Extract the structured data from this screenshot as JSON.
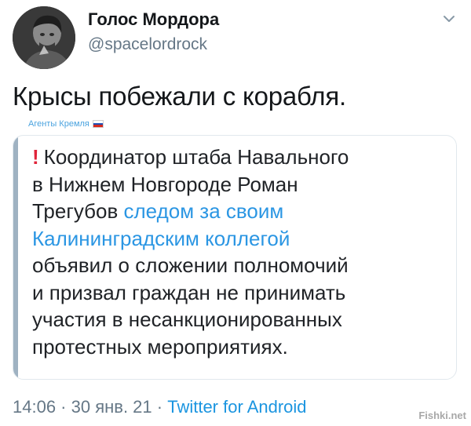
{
  "author": {
    "display_name": "Голос Мордора",
    "handle": "@spacelordrock"
  },
  "tweet": {
    "text": "Крысы побежали с корабля."
  },
  "source_caption": {
    "label": "Агенты Кремля",
    "flag_colors": [
      "#ffffff",
      "#1f4fb5",
      "#d52b1e"
    ]
  },
  "card": {
    "exclaim": "❗",
    "line1": "Координатор штаба Навального",
    "line2": "в Нижнем Новгороде Роман",
    "line3_plain": "Трегубов ",
    "line3_link": "следом за своим",
    "line4_link": "Калининградским коллегой",
    "line5": "объявил о сложении полномочий",
    "line6": "и призвал граждан не принимать",
    "line7": "участия в несанкционированных",
    "line8": "протестных мероприятиях."
  },
  "meta": {
    "time": "14:06",
    "sep1": " · ",
    "date": "30 янв. 21",
    "sep2": " · ",
    "app": "Twitter for Android"
  },
  "watermark": "Fishki.net",
  "colors": {
    "link": "#2b96e3",
    "muted": "#657786",
    "exclaim": "#e0243a",
    "border": "#e1e8ed",
    "accent_bar": "#9fb2c2"
  },
  "icons": {
    "caret": "chevron-down-icon",
    "exclaim": "exclamation-icon"
  }
}
